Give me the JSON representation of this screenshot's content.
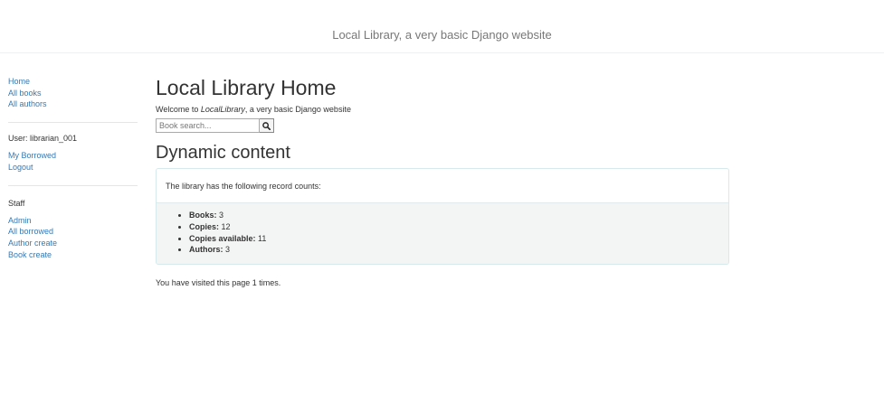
{
  "header": {
    "site_title": "Local Library, a very basic Django website"
  },
  "sidebar": {
    "nav": [
      {
        "label": "Home"
      },
      {
        "label": "All books"
      },
      {
        "label": "All authors"
      }
    ],
    "user_label": "User: librarian_001",
    "account": [
      {
        "label": "My Borrowed"
      },
      {
        "label": "Logout"
      }
    ],
    "staff_heading": "Staff",
    "staff": [
      {
        "label": "Admin"
      },
      {
        "label": "All borrowed"
      },
      {
        "label": "Author create"
      },
      {
        "label": "Book create"
      }
    ]
  },
  "main": {
    "title": "Local Library Home",
    "welcome_prefix": "Welcome to ",
    "welcome_brand": "LocalLibrary",
    "welcome_suffix": ", a very basic Django website",
    "search": {
      "placeholder": "Book search...",
      "value": "",
      "button_icon": "search-icon"
    },
    "dynamic_title": "Dynamic content",
    "panel_heading": "The library has the following record counts:",
    "counts": [
      {
        "label": "Books:",
        "value": "3"
      },
      {
        "label": "Copies:",
        "value": "12"
      },
      {
        "label": "Copies available:",
        "value": "11"
      },
      {
        "label": "Authors:",
        "value": "3"
      }
    ],
    "visits_text": "You have visited this page 1 times."
  },
  "colors": {
    "link": "#337ab7",
    "text": "#333333",
    "site_title": "#777777",
    "panel_border": "#d6e9ec",
    "panel_body_bg": "#f3f4f4"
  }
}
